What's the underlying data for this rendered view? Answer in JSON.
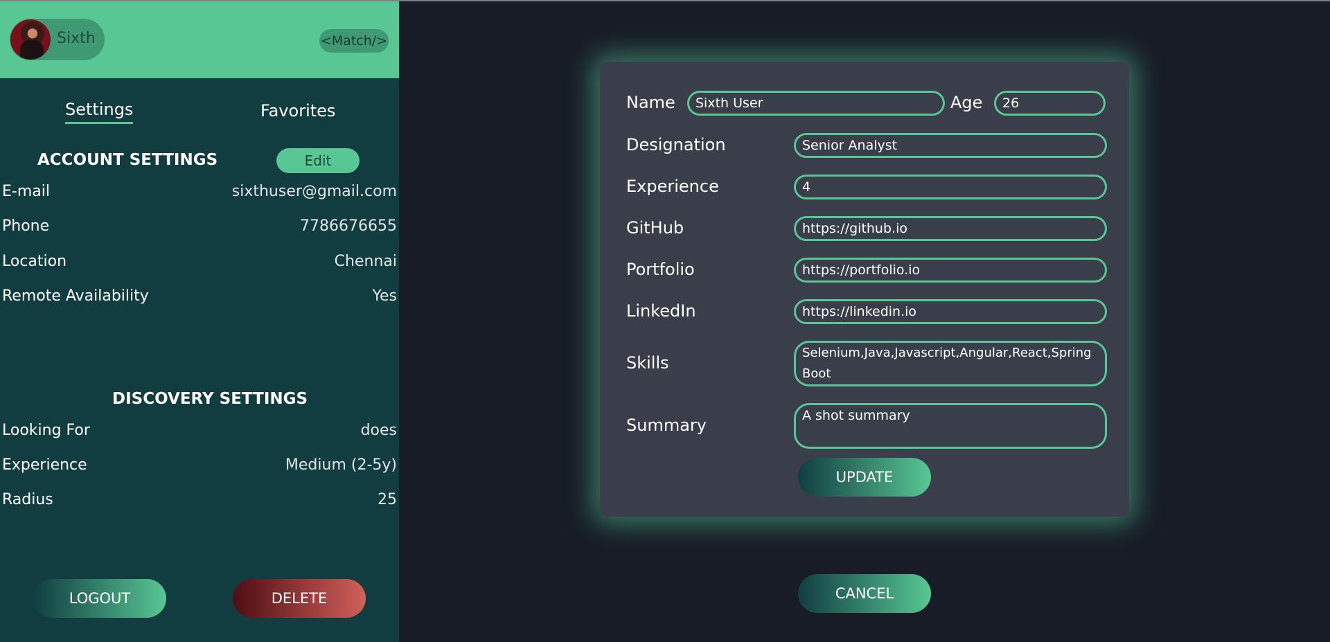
{
  "header": {
    "user_name": "Sixth",
    "match_label": "<Match/>"
  },
  "tabs": {
    "settings": "Settings",
    "favorites": "Favorites"
  },
  "account": {
    "title": "ACCOUNT SETTINGS",
    "edit_label": "Edit",
    "rows": [
      {
        "label": "E-mail",
        "value": "sixthuser@gmail.com"
      },
      {
        "label": "Phone",
        "value": "7786676655"
      },
      {
        "label": "Location",
        "value": "Chennai"
      },
      {
        "label": "Remote Availability",
        "value": "Yes"
      }
    ]
  },
  "discovery": {
    "title": "DISCOVERY SETTINGS",
    "rows": [
      {
        "label": "Looking For",
        "value": "does"
      },
      {
        "label": "Experience",
        "value": "Medium (2-5y)"
      },
      {
        "label": "Radius",
        "value": "25"
      }
    ]
  },
  "actions": {
    "logout": "LOGOUT",
    "delete": "DELETE"
  },
  "form": {
    "name_label": "Name",
    "name_value": "Sixth User",
    "age_label": "Age",
    "age_value": "26",
    "designation_label": "Designation",
    "designation_value": "Senior Analyst",
    "experience_label": "Experience",
    "experience_value": "4",
    "github_label": "GitHub",
    "github_value": "https://github.io",
    "portfolio_label": "Portfolio",
    "portfolio_value": "https://portfolio.io",
    "linkedin_label": "LinkedIn",
    "linkedin_value": "https://linkedin.io",
    "skills_label": "Skills",
    "skills_value": "Selenium,Java,Javascript,Angular,React,SpringBoot",
    "summary_label": "Summary",
    "summary_value": "A shot summary",
    "update_label": "UPDATE",
    "cancel_label": "CANCEL"
  },
  "colors": {
    "accent": "#58c793",
    "sidebar_bg": "#113d41",
    "page_bg": "#171c27",
    "modal_bg": "#3a3e4a",
    "delete_red": "#d1605a"
  }
}
